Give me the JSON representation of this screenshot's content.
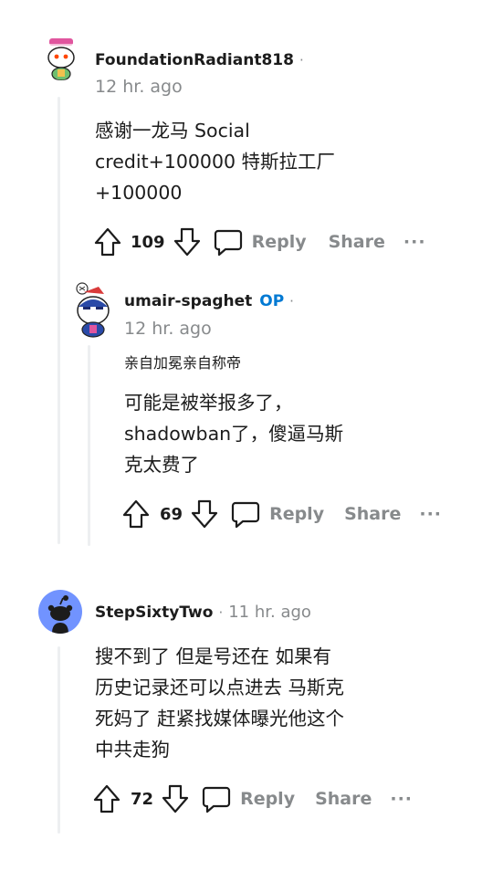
{
  "comments": [
    {
      "username": "FoundationRadiant818",
      "time": "12 hr. ago",
      "body": [
        "感谢一龙马 Social",
        "credit+100000 特斯拉工厂",
        "+100000"
      ],
      "score": "109"
    },
    {
      "username": "umair-spaghet",
      "op_badge": "OP",
      "time": "12 hr. ago",
      "flair": "亲自加冕亲自称帝",
      "body": [
        "可能是被举报多了，",
        "shadowban了，傻逼马斯",
        "克太费了"
      ],
      "score": "69"
    },
    {
      "username": "StepSixtyTwo",
      "time": "11 hr. ago",
      "body": [
        "搜不到了 但是号还在 如果有",
        "历史记录还可以点进去 马斯克",
        "死妈了 赶紧找媒体曝光他这个",
        "中共走狗"
      ],
      "score": "72"
    }
  ],
  "labels": {
    "separator": "·",
    "reply": "Reply",
    "share": "Share",
    "more": "···"
  },
  "colors": {
    "accent_blue": "#0079d3",
    "meta_gray": "#878a8c",
    "thread_line": "#edeff1",
    "avatar_blue": "#7193ff"
  },
  "icons": [
    "upvote-icon",
    "downvote-icon",
    "reply-icon",
    "more-icon",
    "reddit-alien-avatar"
  ]
}
